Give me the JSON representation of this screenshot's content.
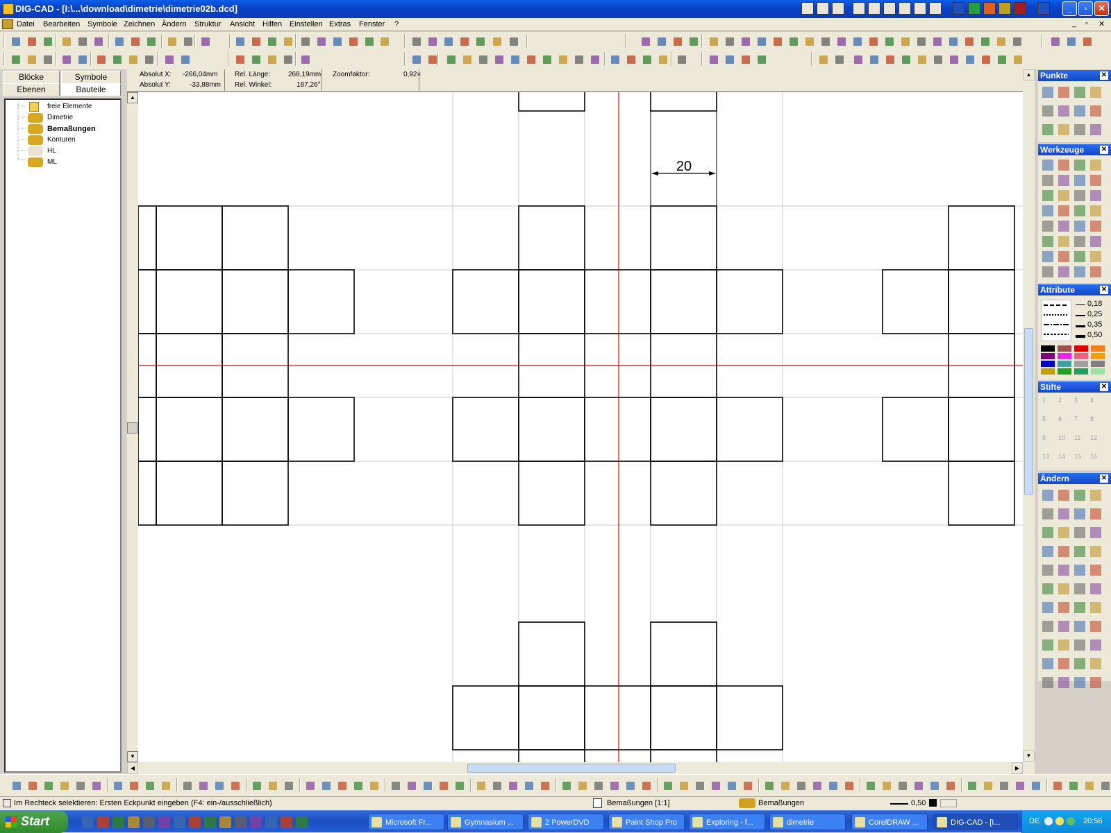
{
  "app": {
    "title": "DIG-CAD - [I:\\...\\download\\dimetrie\\dimetrie02b.dcd]",
    "accent": "#0842c7"
  },
  "menu": [
    "Datei",
    "Bearbeiten",
    "Symbole",
    "Zeichnen",
    "Ändern",
    "Struktur",
    "Ansicht",
    "Hilfen",
    "Einstellen",
    "Extras",
    "Fenster",
    "?"
  ],
  "left_panel": {
    "tabs": [
      "Blöcke",
      "Symbole",
      "Ebenen",
      "Bauteile"
    ],
    "tree": [
      {
        "label": "freie Elemente",
        "icon": "folder-icon",
        "bold": false
      },
      {
        "label": "Dimetrie",
        "icon": "part-group-icon",
        "bold": false
      },
      {
        "label": "Bemaßungen",
        "icon": "part-group-icon",
        "bold": true
      },
      {
        "label": "Konturen",
        "icon": "part-group-icon",
        "bold": false
      },
      {
        "label": "HL",
        "icon": "part-group-hidden-icon",
        "bold": false
      },
      {
        "label": "ML",
        "icon": "part-group-icon",
        "bold": false
      }
    ]
  },
  "coords": {
    "abs_x_label": "Absolut X:",
    "abs_x": "-266,04mm",
    "abs_y_label": "Absolut Y:",
    "abs_y": "-33,88mm",
    "rel_len_label": "Rel. Länge:",
    "rel_len": "268,19mm",
    "rel_angle_label": "Rel. Winkel:",
    "rel_angle": "187,26°",
    "zoom_label": "Zoomfaktor:",
    "zoom": "0,92×"
  },
  "drawing": {
    "dimension_text": "20",
    "axis_color": "#e00000"
  },
  "panels": {
    "punkte": "Punkte",
    "werkzeuge": "Werkzeuge",
    "attribute": "Attribute",
    "line_widths": [
      "0,18",
      "0,25",
      "0,35",
      "0,50"
    ],
    "stifte": "Stifte",
    "pens": [
      "1",
      "2",
      "3",
      "4",
      "5",
      "6",
      "7",
      "8",
      "9",
      "10",
      "11",
      "12",
      "13",
      "14",
      "15",
      "16"
    ],
    "aendern": "Ändern",
    "palette": [
      "#000000",
      "#a05050",
      "#e00000",
      "#f08020",
      "#800080",
      "#f020f0",
      "#f06080",
      "#f0a000",
      "#0000c0",
      "#40a0a0",
      "#a0a0a0",
      "#808080",
      "#c0a000",
      "#20a020",
      "#20a060",
      "#a0e0a0"
    ]
  },
  "status": {
    "message": "Im Rechteck selektieren: Ersten Eckpunkt eingeben (F4: ein-/ausschließlich)",
    "layer": "Bemaßungen [1:1]",
    "part": "Bemaßungen",
    "pen_width": "0,50"
  },
  "taskbar": {
    "start": "Start",
    "tasks": [
      "Microsoft Fr...",
      "Gymnasium ...",
      "2 PowerDVD",
      "Paint Shop Pro",
      "Exploring - f...",
      "dimetrie",
      "CorelDRAW ...",
      "DIG-CAD - [I..."
    ],
    "lang": "DE",
    "clock": "20:56"
  }
}
